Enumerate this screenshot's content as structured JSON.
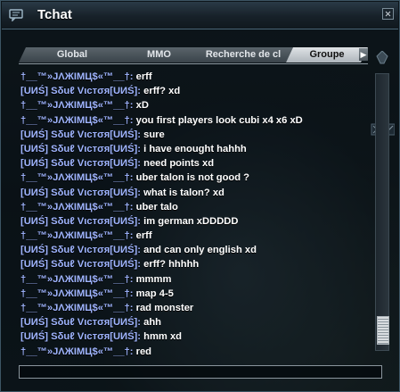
{
  "window": {
    "title": "Tchat",
    "close_icon": "close-icon"
  },
  "tabs": [
    {
      "label": "Global",
      "active": false
    },
    {
      "label": "MMO",
      "active": false
    },
    {
      "label": "Recherche de cl",
      "active": false
    },
    {
      "label": "Groupe",
      "active": true
    }
  ],
  "tab_scroll_icon": "chevron-right-icon",
  "messages": [
    {
      "name": "†__™»JΛЖIMЦ$«™__†:",
      "text": "erff"
    },
    {
      "name": "[UИŚ] Sδuℓ Vιcтσя[UИŚ]:",
      "text": "erff? xd"
    },
    {
      "name": "†__™»JΛЖIMЦ$«™__†:",
      "text": "xD"
    },
    {
      "name": "†__™»JΛЖIMЦ$«™__†:",
      "text": "you first players look cubi x4 x6 xD"
    },
    {
      "name": "[UИŚ] Sδuℓ Vιcтσя[UИŚ]:",
      "text": "sure"
    },
    {
      "name": "[UИŚ] Sδuℓ Vιcтσя[UИŚ]:",
      "text": "i have enought hahhh"
    },
    {
      "name": "[UИŚ] Sδuℓ Vιcтσя[UИŚ]:",
      "text": "need points xd"
    },
    {
      "name": "†__™»JΛЖIMЦ$«™__†:",
      "text": "uber talon is not good ?"
    },
    {
      "name": "[UИŚ] Sδuℓ Vιcтσя[UИŚ]:",
      "text": "what is talon? xd"
    },
    {
      "name": "†__™»JΛЖIMЦ$«™__†:",
      "text": "uber talo"
    },
    {
      "name": "[UИŚ] Sδuℓ Vιcтσя[UИŚ]:",
      "text": "im german xDDDDD"
    },
    {
      "name": "†__™»JΛЖIMЦ$«™__†:",
      "text": "erff"
    },
    {
      "name": "[UИŚ] Sδuℓ Vιcтσя[UИŚ]:",
      "text": "and can only english xd"
    },
    {
      "name": "[UИŚ] Sδuℓ Vιcтσя[UИŚ]:",
      "text": "erff? hhhhh"
    },
    {
      "name": "†__™»JΛЖIMЦ$«™__†:",
      "text": "mmmm"
    },
    {
      "name": "†__™»JΛЖIMЦ$«™__†:",
      "text": "map 4-5"
    },
    {
      "name": "†__™»JΛЖIMЦ$«™__†:",
      "text": "rad monster"
    },
    {
      "name": "[UИŚ] Sδuℓ Vιcтσя[UИŚ]:",
      "text": "ahh"
    },
    {
      "name": "[UИŚ] Sδuℓ Vιcтσя[UИŚ]:",
      "text": "hmm xd"
    },
    {
      "name": "†__™»JΛЖIMЦ$«™__†:",
      "text": "red"
    }
  ],
  "input": {
    "value": "",
    "placeholder": ""
  },
  "scrollbar": {
    "position": 1.0
  },
  "colors": {
    "name": "#9fb4ff",
    "text": "#ffffff",
    "active_tab": "#dfe3e6",
    "border": "#8b969e"
  }
}
